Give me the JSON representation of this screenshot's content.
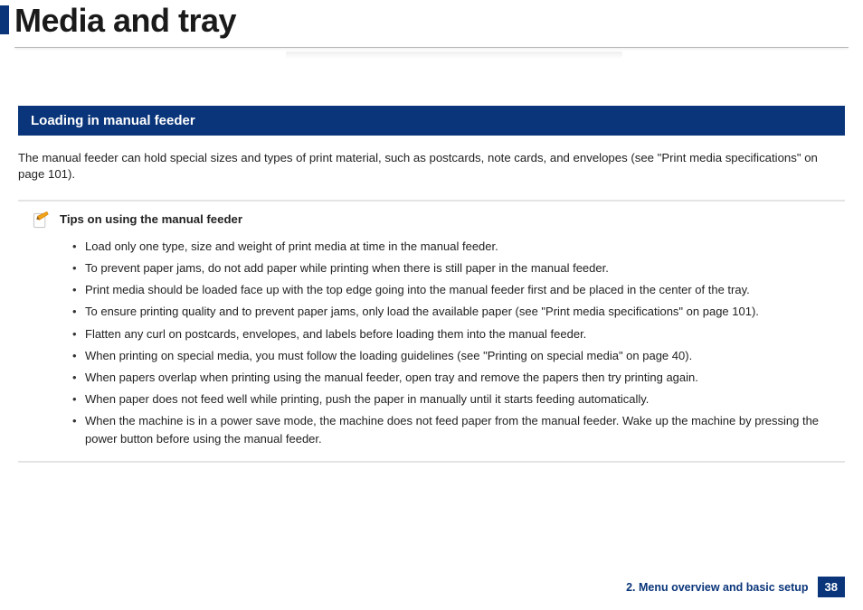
{
  "header": {
    "title": "Media and tray"
  },
  "section": {
    "heading": "Loading in manual feeder"
  },
  "intro": "The manual feeder can hold special sizes and types of print material, such as postcards, note cards, and envelopes (see \"Print media specifications\" on page 101).",
  "tips": {
    "title": "Tips on using the manual feeder",
    "items": [
      "Load only one type, size and weight of print media at time in the manual feeder.",
      "To prevent paper jams, do not add paper while printing when there is still paper in the manual feeder.",
      "Print media should be loaded face up with the top edge going into the manual feeder first and be placed in the center of the tray.",
      "To ensure printing quality and to prevent paper jams, only load the available paper (see \"Print media specifications\" on page 101).",
      "Flatten any curl on postcards, envelopes, and labels before loading them into the manual feeder.",
      "When printing on special media, you must follow the loading guidelines (see \"Printing on special media\" on page 40).",
      "When papers overlap when printing using the manual feeder, open tray and remove the papers then try printing again.",
      "When paper does not feed well while printing, push the paper in manually until it starts feeding automatically.",
      "When the machine is in a power save mode, the machine does not feed paper from the manual feeder. Wake up the machine by pressing the power button before using the manual feeder."
    ]
  },
  "footer": {
    "chapter": "2. Menu overview and basic setup",
    "page": "38"
  }
}
